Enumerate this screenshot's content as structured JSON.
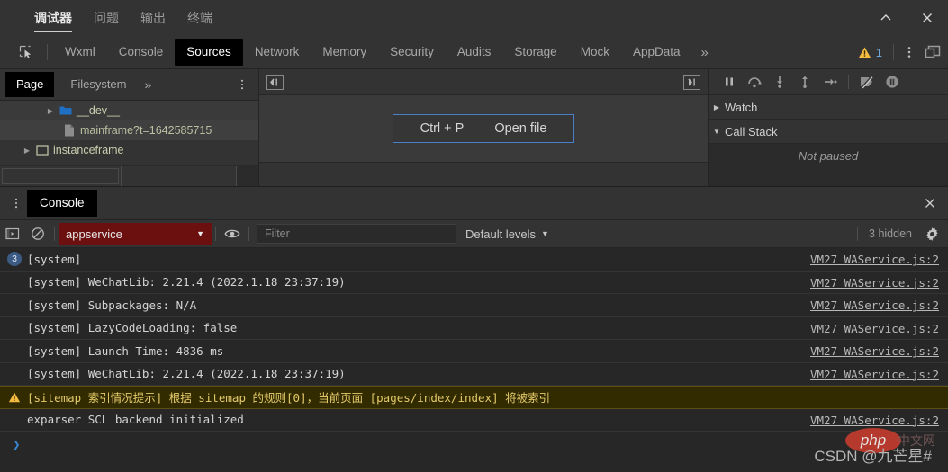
{
  "titlebar": {
    "tabs": [
      {
        "label": "调试器",
        "active": true
      },
      {
        "label": "问题",
        "active": false
      },
      {
        "label": "输出",
        "active": false
      },
      {
        "label": "终端",
        "active": false
      }
    ],
    "minimize_label": "^",
    "close_label": "×"
  },
  "devtools": {
    "inspect_icon": "inspect-element-icon",
    "tabs": [
      {
        "label": "Wxml"
      },
      {
        "label": "Console"
      },
      {
        "label": "Sources"
      },
      {
        "label": "Network"
      },
      {
        "label": "Memory"
      },
      {
        "label": "Security"
      },
      {
        "label": "Audits"
      },
      {
        "label": "Storage"
      },
      {
        "label": "Mock"
      },
      {
        "label": "AppData"
      }
    ],
    "active_tab": "Sources",
    "more_label": "»",
    "warning_count": "1",
    "kebab_label": "⋮",
    "dock_icon": "dock-window-icon"
  },
  "navigator": {
    "tabs": [
      {
        "label": "Page",
        "active": true
      },
      {
        "label": "Filesystem",
        "active": false
      }
    ],
    "more_label": "»",
    "kebab_label": "⋮",
    "tree": [
      {
        "label": "__dev__",
        "icon": "folder-icon",
        "twisty": "▶",
        "indent": 48,
        "state": "hl"
      },
      {
        "label": "mainframe?t=1642585715",
        "icon": "file-icon",
        "twisty": "",
        "indent": 68,
        "state": "sel"
      },
      {
        "label": "instanceframe",
        "icon": "frame-icon",
        "twisty": "▶",
        "indent": 22,
        "state": ""
      }
    ]
  },
  "editor": {
    "left_toggle_icon": "show-navigator-icon",
    "right_toggle_icon": "show-debugger-icon",
    "shortcut_label": "Ctrl + P",
    "action_label": "Open file"
  },
  "debugger": {
    "buttons": [
      {
        "name": "pause-script-execution-icon"
      },
      {
        "name": "step-over-icon"
      },
      {
        "name": "step-into-icon"
      },
      {
        "name": "step-out-icon"
      },
      {
        "name": "step-icon"
      },
      {
        "name": "deactivate-breakpoints-icon"
      },
      {
        "name": "pause-on-exceptions-icon"
      }
    ],
    "watch_label": "Watch",
    "watch_twisty": "▶",
    "callstack_label": "Call Stack",
    "callstack_twisty": "▼",
    "callstack_empty": "Not paused"
  },
  "drawer": {
    "kebab_label": "⋮",
    "tab_label": "Console",
    "close_label": "✕"
  },
  "console_toolbar": {
    "sidebar_icon": "console-sidebar-icon",
    "clear_icon": "clear-console-icon",
    "context": "appservice",
    "context_arrow": "▼",
    "eye_icon": "live-expression-icon",
    "filter_placeholder": "Filter",
    "filter_value": "",
    "levels_label": "Default levels",
    "levels_arrow": "▼",
    "hidden_label": "3 hidden",
    "settings_icon": "gear-icon"
  },
  "console_log": {
    "source_link": "VM27 WAService.js:2",
    "rows": [
      {
        "badge": "3",
        "text": "[system]",
        "source": "VM27 WAService.js:2",
        "level": "info"
      },
      {
        "badge": "",
        "text": "[system] WeChatLib: 2.21.4 (2022.1.18 23:37:19)",
        "source": "VM27 WAService.js:2",
        "level": "info"
      },
      {
        "badge": "",
        "text": "[system] Subpackages: N/A",
        "source": "VM27 WAService.js:2",
        "level": "info"
      },
      {
        "badge": "",
        "text": "[system] LazyCodeLoading: false",
        "source": "VM27 WAService.js:2",
        "level": "info"
      },
      {
        "badge": "",
        "text": "[system] Launch Time: 4836 ms",
        "source": "VM27 WAService.js:2",
        "level": "info"
      },
      {
        "badge": "",
        "text": "[system] WeChatLib: 2.21.4 (2022.1.18 23:37:19)",
        "source": "VM27 WAService.js:2",
        "level": "info"
      },
      {
        "badge": "",
        "text": "[sitemap 索引情况提示] 根据 sitemap 的规则[0]，当前页面 [pages/index/index] 将被索引",
        "source": "",
        "level": "warn"
      },
      {
        "badge": "",
        "text": "exparser SCL backend initialized",
        "source": "VM27 WAService.js:2",
        "level": "info"
      }
    ],
    "prompt_chevron": "❯"
  },
  "watermark": {
    "text": "CSDN @九芒星#",
    "logo_text": "php",
    "logo_suffix": "中文网"
  },
  "colors": {
    "accent_blue": "#4a7ec7",
    "warn_yellow": "#e3c96a",
    "context_red": "#6b0f0f",
    "panel_bg": "#333333",
    "console_bg": "#272727"
  }
}
